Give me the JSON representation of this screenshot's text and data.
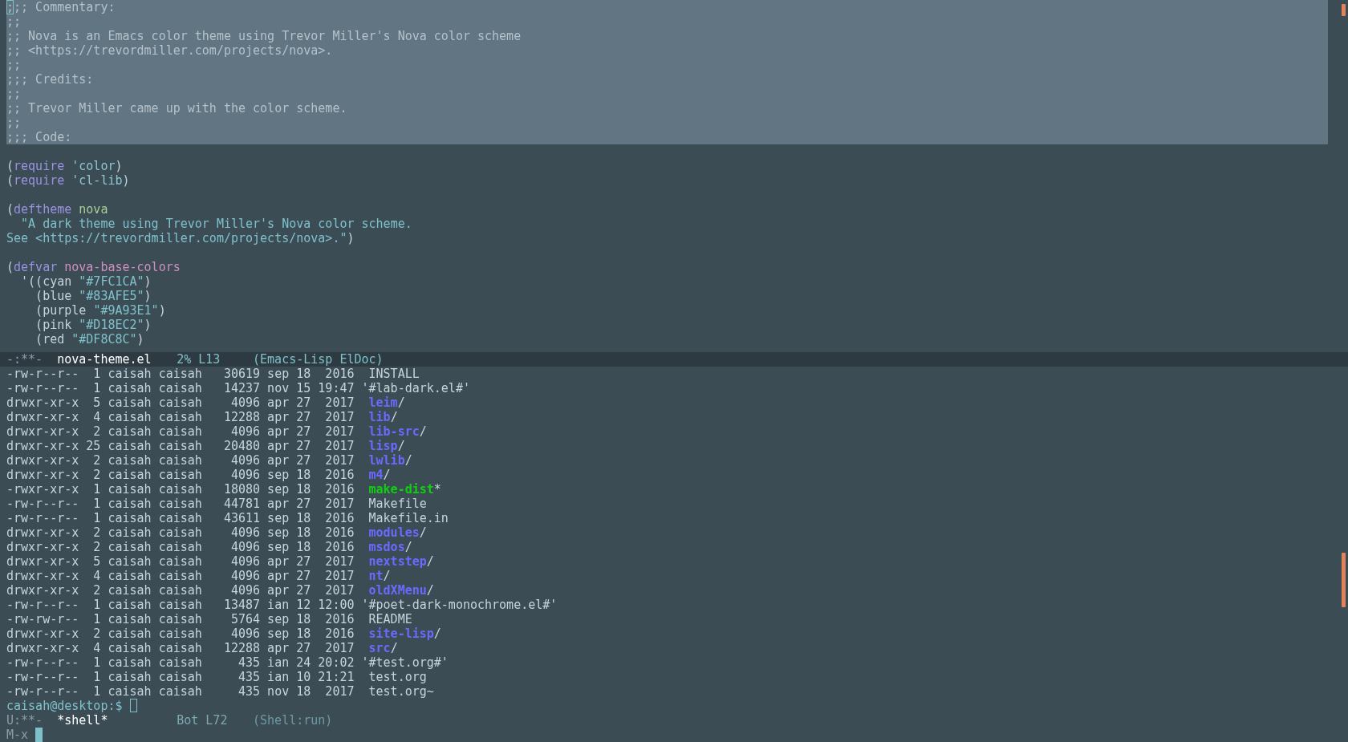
{
  "editor": {
    "lines": [
      {
        "kind": "code",
        "selected": true,
        "segments": [
          {
            "text": ";",
            "kind": "comment",
            "cursor": true
          },
          {
            "text": ";; Commentary:",
            "kind": "comment"
          }
        ]
      },
      {
        "kind": "code",
        "selected": true,
        "segments": [
          {
            "text": ";;",
            "kind": "comment"
          }
        ]
      },
      {
        "kind": "code",
        "selected": true,
        "segments": [
          {
            "text": ";; Nova is an Emacs color theme using Trevor Miller's Nova color scheme",
            "kind": "comment"
          }
        ]
      },
      {
        "kind": "code",
        "selected": true,
        "segments": [
          {
            "text": ";; <https://trevordmiller.com/projects/nova>.",
            "kind": "comment"
          }
        ]
      },
      {
        "kind": "code",
        "selected": true,
        "segments": [
          {
            "text": ";;",
            "kind": "comment"
          }
        ]
      },
      {
        "kind": "code",
        "selected": true,
        "segments": [
          {
            "text": ";;; Credits:",
            "kind": "comment"
          }
        ]
      },
      {
        "kind": "code",
        "selected": true,
        "segments": [
          {
            "text": ";;",
            "kind": "comment"
          }
        ]
      },
      {
        "kind": "code",
        "selected": true,
        "segments": [
          {
            "text": ";; Trevor Miller came up with the color scheme.",
            "kind": "comment"
          }
        ]
      },
      {
        "kind": "code",
        "selected": true,
        "segments": [
          {
            "text": ";;",
            "kind": "comment"
          }
        ]
      },
      {
        "kind": "code",
        "selected": true,
        "segments": [
          {
            "text": ";;; Code:",
            "kind": "comment"
          }
        ]
      },
      {
        "kind": "blank"
      },
      {
        "kind": "code",
        "selected": false,
        "segments": [
          {
            "text": "(",
            "kind": "plain"
          },
          {
            "text": "require",
            "kind": "keyword"
          },
          {
            "text": " 'color",
            "kind": "quoted"
          },
          {
            "text": ")",
            "kind": "plain"
          }
        ]
      },
      {
        "kind": "code",
        "selected": false,
        "segments": [
          {
            "text": "(",
            "kind": "plain"
          },
          {
            "text": "require",
            "kind": "keyword"
          },
          {
            "text": " 'cl-lib",
            "kind": "quoted"
          },
          {
            "text": ")",
            "kind": "plain"
          }
        ]
      },
      {
        "kind": "blank"
      },
      {
        "kind": "code",
        "selected": false,
        "segments": [
          {
            "text": "(",
            "kind": "plain"
          },
          {
            "text": "deftheme",
            "kind": "keyword"
          },
          {
            "text": " nova",
            "kind": "name"
          }
        ]
      },
      {
        "kind": "code",
        "selected": false,
        "segments": [
          {
            "text": "  \"A dark theme using Trevor Miller's Nova color scheme.",
            "kind": "string"
          }
        ]
      },
      {
        "kind": "code",
        "selected": false,
        "segments": [
          {
            "text": "See <https://trevordmiller.com/projects/nova>.\"",
            "kind": "string"
          },
          {
            "text": ")",
            "kind": "plain"
          }
        ]
      },
      {
        "kind": "blank"
      },
      {
        "kind": "code",
        "selected": false,
        "segments": [
          {
            "text": "(",
            "kind": "plain"
          },
          {
            "text": "defvar",
            "kind": "keyword"
          },
          {
            "text": " nova-base-colors",
            "kind": "variable"
          }
        ]
      },
      {
        "kind": "code",
        "selected": false,
        "segments": [
          {
            "text": "  '((cyan ",
            "kind": "plain"
          },
          {
            "text": "\"#7FC1CA\"",
            "kind": "string"
          },
          {
            "text": ")",
            "kind": "plain"
          }
        ]
      },
      {
        "kind": "code",
        "selected": false,
        "segments": [
          {
            "text": "    (blue ",
            "kind": "plain"
          },
          {
            "text": "\"#83AFE5\"",
            "kind": "string"
          },
          {
            "text": ")",
            "kind": "plain"
          }
        ]
      },
      {
        "kind": "code",
        "selected": false,
        "segments": [
          {
            "text": "    (purple ",
            "kind": "plain"
          },
          {
            "text": "\"#9A93E1\"",
            "kind": "string"
          },
          {
            "text": ")",
            "kind": "plain"
          }
        ]
      },
      {
        "kind": "code",
        "selected": false,
        "segments": [
          {
            "text": "    (pink ",
            "kind": "plain"
          },
          {
            "text": "\"#D18EC2\"",
            "kind": "string"
          },
          {
            "text": ")",
            "kind": "plain"
          }
        ]
      },
      {
        "kind": "code",
        "selected": false,
        "segments": [
          {
            "text": "    (red ",
            "kind": "plain"
          },
          {
            "text": "\"#DF8C8C\"",
            "kind": "string"
          },
          {
            "text": ")",
            "kind": "plain"
          }
        ]
      }
    ]
  },
  "editor_mode_line": {
    "status": "-:**-",
    "buffer": "nova-theme.el",
    "position": "2% L13",
    "modes": "(Emacs-Lisp ElDoc)",
    "active": true
  },
  "shell": {
    "entries": [
      {
        "details": "-rw-r--r--  1 caisah caisah   30619 sep 18  2016",
        "name": "INSTALL",
        "kind": "file"
      },
      {
        "details": "-rw-r--r--  1 caisah caisah   14237 nov 15 19:47",
        "name": "'#lab-dark.el#'",
        "kind": "quoted"
      },
      {
        "details": "drwxr-xr-x  5 caisah caisah    4096 apr 27  2017",
        "name": "leim",
        "suffix": "/",
        "kind": "directory"
      },
      {
        "details": "drwxr-xr-x  4 caisah caisah   12288 apr 27  2017",
        "name": "lib",
        "suffix": "/",
        "kind": "directory"
      },
      {
        "details": "drwxr-xr-x  2 caisah caisah    4096 apr 27  2017",
        "name": "lib-src",
        "suffix": "/",
        "kind": "directory"
      },
      {
        "details": "drwxr-xr-x 25 caisah caisah   20480 apr 27  2017",
        "name": "lisp",
        "suffix": "/",
        "kind": "directory"
      },
      {
        "details": "drwxr-xr-x  2 caisah caisah    4096 apr 27  2017",
        "name": "lwlib",
        "suffix": "/",
        "kind": "directory"
      },
      {
        "details": "drwxr-xr-x  2 caisah caisah    4096 sep 18  2016",
        "name": "m4",
        "suffix": "/",
        "kind": "directory"
      },
      {
        "details": "-rwxr-xr-x  1 caisah caisah   18080 sep 18  2016",
        "name": "make-dist",
        "suffix": "*",
        "kind": "executable"
      },
      {
        "details": "-rw-r--r--  1 caisah caisah   44781 apr 27  2017",
        "name": "Makefile",
        "kind": "file"
      },
      {
        "details": "-rw-r--r--  1 caisah caisah   43611 sep 18  2016",
        "name": "Makefile.in",
        "kind": "file"
      },
      {
        "details": "drwxr-xr-x  2 caisah caisah    4096 sep 18  2016",
        "name": "modules",
        "suffix": "/",
        "kind": "directory"
      },
      {
        "details": "drwxr-xr-x  2 caisah caisah    4096 sep 18  2016",
        "name": "msdos",
        "suffix": "/",
        "kind": "directory"
      },
      {
        "details": "drwxr-xr-x  5 caisah caisah    4096 apr 27  2017",
        "name": "nextstep",
        "suffix": "/",
        "kind": "directory"
      },
      {
        "details": "drwxr-xr-x  4 caisah caisah    4096 apr 27  2017",
        "name": "nt",
        "suffix": "/",
        "kind": "directory"
      },
      {
        "details": "drwxr-xr-x  2 caisah caisah    4096 apr 27  2017",
        "name": "oldXMenu",
        "suffix": "/",
        "kind": "directory"
      },
      {
        "details": "-rw-r--r--  1 caisah caisah   13487 ian 12 12:00",
        "name": "'#poet-dark-monochrome.el#'",
        "kind": "quoted"
      },
      {
        "details": "-rw-rw-r--  1 caisah caisah    5764 sep 18  2016",
        "name": "README",
        "kind": "file"
      },
      {
        "details": "drwxr-xr-x  2 caisah caisah    4096 sep 18  2016",
        "name": "site-lisp",
        "suffix": "/",
        "kind": "directory"
      },
      {
        "details": "drwxr-xr-x  4 caisah caisah   12288 apr 27  2017",
        "name": "src",
        "suffix": "/",
        "kind": "directory"
      },
      {
        "details": "-rw-r--r--  1 caisah caisah     435 ian 24 20:02",
        "name": "'#test.org#'",
        "kind": "quoted"
      },
      {
        "details": "-rw-r--r--  1 caisah caisah     435 ian 10 21:21",
        "name": "test.org",
        "kind": "file"
      },
      {
        "details": "-rw-r--r--  1 caisah caisah     435 nov 18  2017",
        "name": "test.org~",
        "kind": "file"
      }
    ],
    "prompt": {
      "text": "caisah@desktop:$",
      "cursor": true
    }
  },
  "shell_mode_line": {
    "status": "U:**-",
    "buffer": "*shell*",
    "position": "Bot L72",
    "modes": "(Shell:run)",
    "active": false
  },
  "minibuffer": {
    "prompt": "M-x",
    "cursor": true
  }
}
